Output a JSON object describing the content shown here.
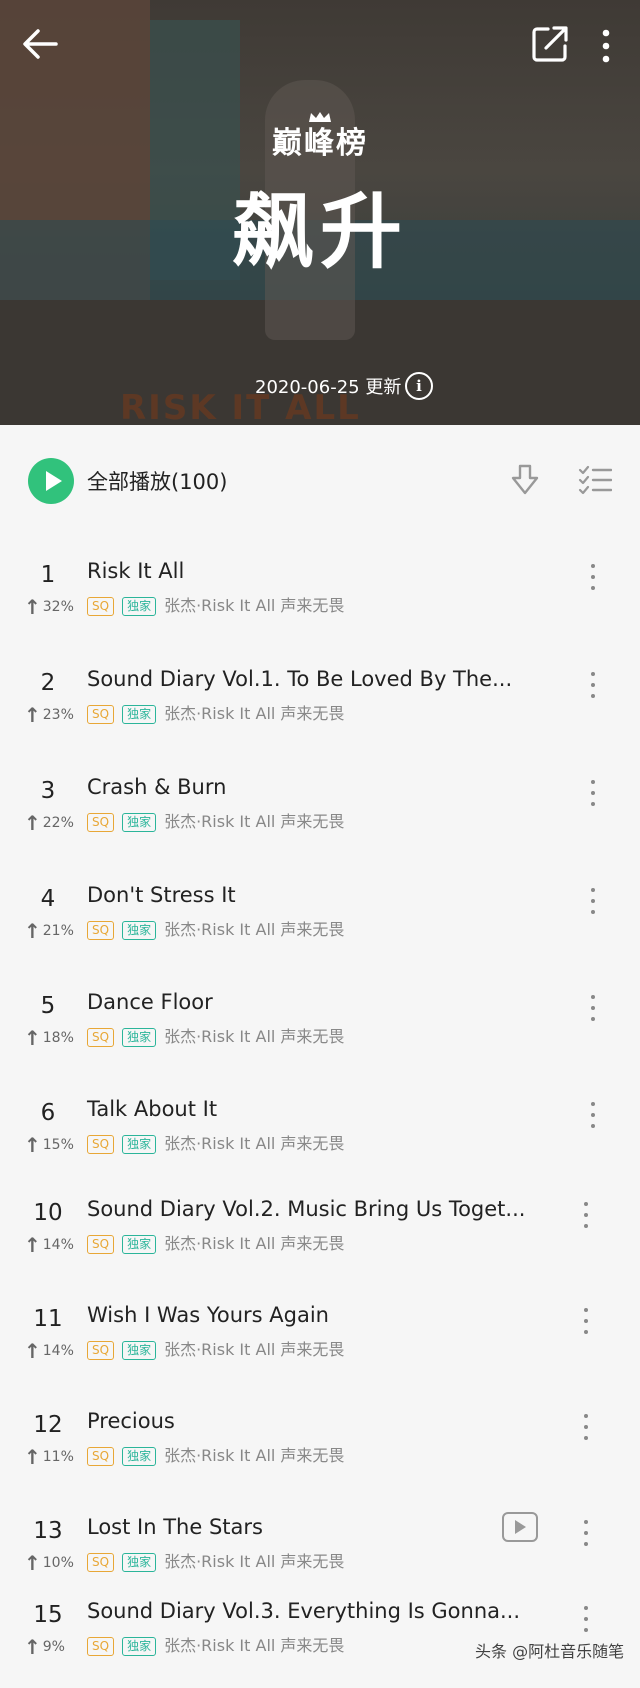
{
  "header": {
    "brand": "巅峰榜",
    "title": "飙升",
    "update_date": "2020-06-25 更新",
    "info_symbol": "i",
    "banner_text": "RISK IT ALL"
  },
  "icons": {
    "back": "back-arrow-icon",
    "share": "share-icon",
    "more": "more-vertical-icon",
    "play": "play-icon",
    "download": "download-icon",
    "multi_select": "multi-select-icon",
    "mv": "video-icon"
  },
  "toolbar": {
    "play_all_label": "全部播放(100)"
  },
  "colors": {
    "accent": "#31c27c",
    "sq_badge": "#e8a736",
    "exclusive_badge": "#2bb59a"
  },
  "badges": {
    "sq": "SQ",
    "exclusive": "独家"
  },
  "songs": [
    {
      "rank": "1",
      "trend": "32%",
      "title": "Risk It All",
      "meta": "张杰·Risk It All 声来无畏"
    },
    {
      "rank": "2",
      "trend": "23%",
      "title": "Sound Diary Vol.1. To Be Loved By The...",
      "meta": "张杰·Risk It All 声来无畏"
    },
    {
      "rank": "3",
      "trend": "22%",
      "title": "Crash & Burn",
      "meta": "张杰·Risk It All 声来无畏"
    },
    {
      "rank": "4",
      "trend": "21%",
      "title": "Don't Stress It",
      "meta": "张杰·Risk It All 声来无畏"
    },
    {
      "rank": "5",
      "trend": "18%",
      "title": "Dance Floor",
      "meta": "张杰·Risk It All 声来无畏"
    },
    {
      "rank": "6",
      "trend": "15%",
      "title": "Talk About It",
      "meta": "张杰·Risk It All 声来无畏"
    },
    {
      "rank": "10",
      "trend": "14%",
      "title": "Sound Diary Vol.2. Music Bring Us Toget...",
      "meta": "张杰·Risk It All 声来无畏"
    },
    {
      "rank": "11",
      "trend": "14%",
      "title": "Wish I Was Yours Again",
      "meta": "张杰·Risk It All 声来无畏"
    },
    {
      "rank": "12",
      "trend": "11%",
      "title": "Precious",
      "meta": "张杰·Risk It All 声来无畏"
    },
    {
      "rank": "13",
      "trend": "10%",
      "title": "Lost In The Stars",
      "meta": "张杰·Risk It All 声来无畏"
    },
    {
      "rank": "15",
      "trend": "9%",
      "title": "Sound Diary Vol.3. Everything Is Gonna...",
      "meta": "张杰·Risk It All 声来无畏"
    }
  ],
  "watermark": "头条 @阿杜音乐随笔"
}
